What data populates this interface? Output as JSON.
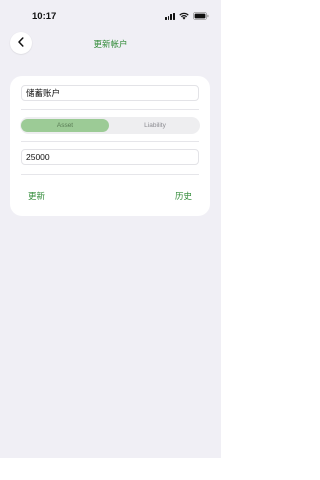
{
  "status_bar": {
    "time": "10:17",
    "icons": [
      "signal-icon",
      "wifi-icon",
      "battery-icon"
    ]
  },
  "nav": {
    "back_icon": "chevron-left-icon",
    "title": "更新帐户"
  },
  "form": {
    "account_name": "储蓄账户",
    "type_segments": [
      "Asset",
      "Liability"
    ],
    "selected_segment": "Asset",
    "amount": "25000"
  },
  "actions": {
    "update_label": "更新",
    "history_label": "历史"
  },
  "colors": {
    "accent": "#2f8a36",
    "selected_segment_bg": "#9ccb96",
    "background": "#f0eff5",
    "card": "#ffffff"
  }
}
